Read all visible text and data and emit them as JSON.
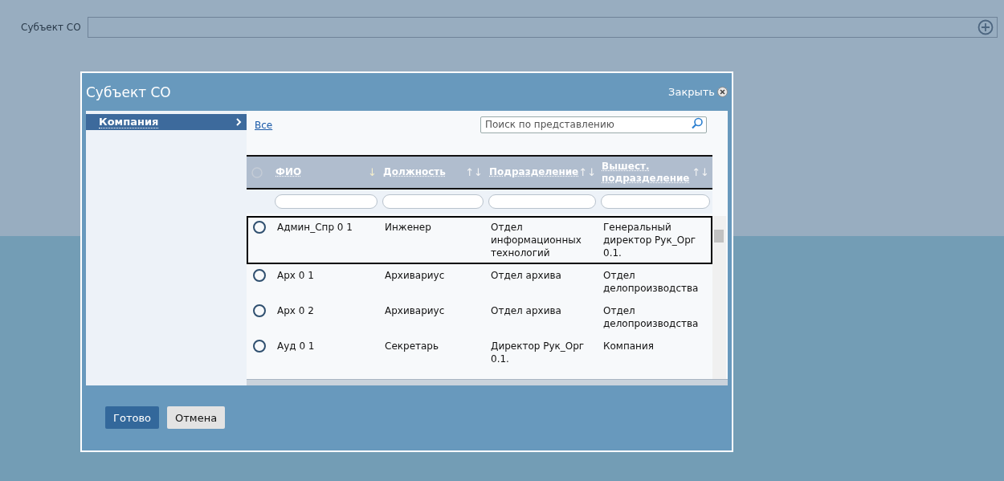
{
  "form": {
    "label": "Субъект СО"
  },
  "dialog": {
    "title": "Субъект СО",
    "close": "Закрыть",
    "sidebar": {
      "items": [
        {
          "label": "Компания",
          "selected": true
        }
      ]
    },
    "filter_link": "Все",
    "search": {
      "placeholder": "Поиск по представлению"
    },
    "table": {
      "columns": [
        {
          "label": "ФИО",
          "sort": "↓"
        },
        {
          "label": "Должность",
          "sort": "↑↓"
        },
        {
          "label": "Подразделение",
          "sort": "↑↓"
        },
        {
          "label": "Вышест. подразделение",
          "sort": "↑↓"
        }
      ],
      "select_all": {
        "selected": false
      },
      "rows": [
        {
          "selected": false,
          "focused": true,
          "cells": [
            "Админ_Спр 0 1",
            "Инженер",
            "Отдел информационных технологий",
            "Генеральный директор Рук_Орг 0.1."
          ]
        },
        {
          "selected": false,
          "focused": false,
          "cells": [
            "Арх 0 1",
            "Архивариус",
            "Отдел архива",
            "Отдел делопроизводства"
          ]
        },
        {
          "selected": false,
          "focused": false,
          "cells": [
            "Арх 0 2",
            "Архивариус",
            "Отдел архива",
            "Отдел делопроизводства"
          ]
        },
        {
          "selected": false,
          "focused": false,
          "cells": [
            "Ауд 0 1",
            "Секретарь",
            "Директор Рук_Орг 0.1.",
            "Компания"
          ]
        }
      ]
    },
    "buttons": [
      {
        "label": "Готово",
        "kind": "primary"
      },
      {
        "label": "Отмена",
        "kind": "secondary"
      }
    ]
  }
}
